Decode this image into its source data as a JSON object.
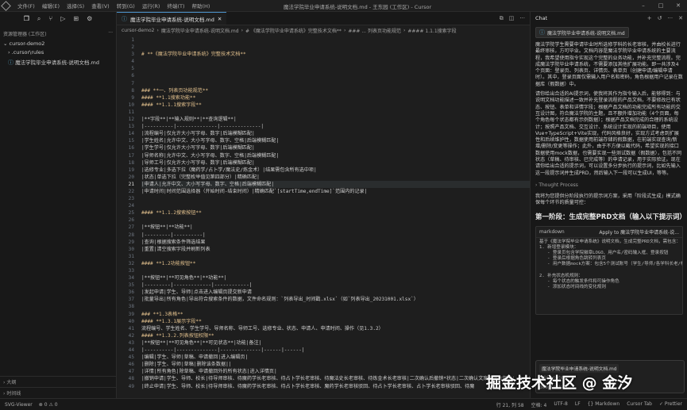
{
  "window": {
    "title": "魔法学院毕业申请系统-说明文档.md - 王东园 (工作区) - Cursor",
    "menu": [
      "文件(F)",
      "编辑(E)",
      "选择(S)",
      "查看(V)",
      "转到(G)",
      "运行(R)",
      "终端(T)",
      "帮助(H)"
    ]
  },
  "sidebar": {
    "section_title": "资源管理器 (工作区)",
    "tree": [
      {
        "label": "cursor-demo2",
        "level": 0
      },
      {
        "label": ".cursor\\rules",
        "level": 1
      },
      {
        "label": "魔法学院毕业申请系统-说明文档.md",
        "level": 1
      }
    ],
    "bottom": [
      "大纲",
      "时间线"
    ]
  },
  "editor": {
    "tab": "魔法学院毕业申请系统-说明文档.md",
    "breadcrumb": [
      "cursor-demo2",
      "魔法学院毕业申请系统-说明文档.md",
      "# 《魔法学院毕业申请系统》完整技术文档**",
      "### ... 列表页功能规范",
      "#### 1.1.1搜索字段"
    ],
    "current_line": 21,
    "lines": [
      {
        "n": "1",
        "t": ""
      },
      {
        "n": "2",
        "t": ""
      },
      {
        "n": "3",
        "t": "# **《魔法学院毕业申请系统》完整技术文档**",
        "h": true
      },
      {
        "n": "4",
        "t": ""
      },
      {
        "n": "5",
        "t": ""
      },
      {
        "n": "6",
        "t": ""
      },
      {
        "n": "7",
        "t": ""
      },
      {
        "n": "8",
        "t": "### **一、列表页功能规范**",
        "h": true
      },
      {
        "n": "9",
        "t": "#### **1.1搜索功能**",
        "h": true
      },
      {
        "n": "10",
        "t": "#### **1.1.1搜索字段**",
        "h": true
      },
      {
        "n": "11",
        "t": ""
      },
      {
        "n": "12",
        "t": "|**字段**|**输入规则**|**查询逻辑**|"
      },
      {
        "n": "13",
        "t": "|----------|--------------|--------------|"
      },
      {
        "n": "14",
        "t": "|流程编号|仅允许大小写字母、数字|后端模糊匹配|"
      },
      {
        "n": "15",
        "t": "|学生姓名|允许中文、大小写字母、数字、空格|后端模糊匹配|"
      },
      {
        "n": "16",
        "t": "|学生学号|仅允许大小写字母、数字|后端模糊匹配|"
      },
      {
        "n": "17",
        "t": "|导师名称|允许中文、大小写字母、数字、空格|后端模糊匹配|"
      },
      {
        "n": "18",
        "t": "|导师工号|仅允许大小写字母、数字|后端模糊匹配|"
      },
      {
        "n": "19",
        "t": "|选修专业|多选下拉（魔药学/占卜学/魔法史/炼金术）|结果需包含所有选中项|"
      },
      {
        "n": "20",
        "t": "|状态|单选下拉（完整枚举值见第四部分）|精确匹配|"
      },
      {
        "n": "21",
        "t": "|申请人|允许中文、大小写字母、数字、空格|后端模糊匹配|"
      },
      {
        "n": "22",
        "t": "|申请时间|时间范围选择器（开始时间-结束时间）|精确匹配`[startTime,endTime]`范围内的记录|"
      },
      {
        "n": "23",
        "t": ""
      },
      {
        "n": "24",
        "t": ""
      },
      {
        "n": "25",
        "t": "#### **1.1.2搜索按钮**",
        "h": true
      },
      {
        "n": "26",
        "t": ""
      },
      {
        "n": "27",
        "t": "|**按钮**|**功能**|"
      },
      {
        "n": "28",
        "t": "|---------|----------|"
      },
      {
        "n": "29",
        "t": "|查询|根据搜索条件筛选结果"
      },
      {
        "n": "30",
        "t": "|重置|清空搜索字段并刷新列表"
      },
      {
        "n": "31",
        "t": ""
      },
      {
        "n": "32",
        "t": "#### **1.2功能按钮**",
        "h": true
      },
      {
        "n": "33",
        "t": ""
      },
      {
        "n": "34",
        "t": "|**按钮**|**可见角色**|**功能**|"
      },
      {
        "n": "35",
        "t": "|---------|-------------|------------|"
      },
      {
        "n": "36",
        "t": "|发起申请|学生、导师|点击进入编辑页提交新申请"
      },
      {
        "n": "37",
        "t": "|批量导出|所有角色|导出符合搜索条件的数据，文件命名规则：`列表导出_时间戳.xlsx`（如`列表导出_20231001.xlsx`）"
      },
      {
        "n": "38",
        "t": ""
      },
      {
        "n": "39",
        "t": "### **1.3表格**",
        "h": true
      },
      {
        "n": "40",
        "t": "#### **1.3.1展示字段**",
        "h": true
      },
      {
        "n": "41",
        "t": "流程编号、学生姓名、学生学号、导师名称、导师工号、选修专业、状态、申请人、申请时间、操作（见1.3.2）"
      },
      {
        "n": "42",
        "t": "#### **1.3.2.列表按钮权限**",
        "h": true
      },
      {
        "n": "43",
        "t": "|**按钮**|**可见角色**|**可见状态**|功能|备注|"
      },
      {
        "n": "44",
        "t": "|----------|--------------|--------------|------|------|"
      },
      {
        "n": "45",
        "t": "|编辑|学生、导师|草稿、申请撤回|进入编辑页|"
      },
      {
        "n": "46",
        "t": "|删除|学生、导师|草稿|删除该条数据||"
      },
      {
        "n": "47",
        "t": "|详情|所有角色|除草稿、申请撤回外的所有状态|进入详情页|"
      },
      {
        "n": "48",
        "t": "|撤销申请|学生、导师、校长|待导师审核、待魔药学长老审核、待占卜学长老审核、待魔法史长老审核、待炼金术长老审核|二次确认后撤销*状态|二次确认文案见第六部分：<br>待导师审核状态时，导师没有撤销申请的按钮|二次确认文案见第六部分"
      },
      {
        "n": "49",
        "t": "|终止申请|学生、导师、校长|待导师审核、待魔药学长老审核、待占卜学长老审核、魔药学长老审核驳回、待占卜学长老审核、占卜学长老审核驳回、待魔"
      }
    ]
  },
  "chat": {
    "title": "Chat",
    "context_chip": "魔法学院毕业申请系统-说明文档.md",
    "intro": "魔法学院学生需要申请毕业时所选修学科的长老审核，并由校长进行最终审核，方可毕业。文档内容是魔法学院毕业申请系统的主要流程，我希望使用指令实现这个完整的业务功能，并补充完整流程。完成魔法学院毕业申请系统，不需要添加其他扩展功能。即一共涉及4个页面：登录页、列表页、详情页、表单页（创建申请/编辑申请时）。其中，登录页面仅需输入用户名和密码，角色根据用户记录在数据库（假数据）中。",
    "instructions": "请你给出合适的AI提示词，使我将其作为指令输入后，能够得到：与说明文档功能描述一致并补充登录流程的产品文档，不要修改已有状态、按钮、表单和详情字段；根据产品文档的功能完成所有功能的交互设计图，符合魔法学院的主题，且不额外增加功能（4个页面，每个角色每个状态都有示例数据）；根据产品文档完成的合理的系统设计；按照产品文档、交互设计、系统设计实现的前端项目，使用Vue+TypeScript+Vite实现，代码风格良好，实现方式考虑到扩展性和后续维护性，数据使用前端存储的假数据，在前端实现查询/新增/删除/变更等操作；此外，由于不方便以截代码，希望实现的接口数据使用mock数据，也需要实现一些测试数据（假数据），包括不同状态（草稿、待审核、已完成等）的申请记录，用于实际验证。现在请你给出合适的提示词，可以设置多分步执行的提示词，比如先输入这一段提示词并生成PRD，然后输入下一段可以生成UI，等等。",
    "thought_label": "Thought Process",
    "reply_intro": "我将为您提供分阶段执行的提示词方案，采用「阶段式生成」模式确保每个环节的质量可控：",
    "phase_title": "第一阶段：生成完整PRD文档（输入以下提示词）",
    "code_lang": "markdown",
    "apply_label": "Apply to 魔法学院毕业申请系统-说...",
    "code_lines": [
      "基于《魔法学院毕业申请系统》说明文档，生成完整PRD文档，需包含：",
      "1. 新增登录模块：",
      "   - 登录页包含学院徽章LOGO、用户名/密码输入框、登录按钮",
      "   - 登录后根据角色跳转列表页",
      "   - 用户数据mock方案：包含5个测试账号（学生/导师/各学科长老/校长）",
      "",
      "2. 补充状态机规则：",
      "   - 每个状态的触发条件和可操作角色",
      "   - 添加状态时间线的变化规则"
    ],
    "input_chip": "魔法学院毕业申请系统-说明文档.md",
    "input_placeholder": "Add context",
    "model_label": "deepseek-r1",
    "submit_label": "⏎ submit"
  },
  "statusbar": {
    "left": [
      "SVG-Viewer",
      "⊗ 0 ⚠ 0"
    ],
    "right": [
      "行 21, 列 58",
      "空格: 4",
      "UTF-8",
      "LF",
      "{} Markdown",
      "Cursor Tab",
      "✓ Prettier"
    ]
  },
  "watermark": "掘金技术社区 @ 金汐"
}
